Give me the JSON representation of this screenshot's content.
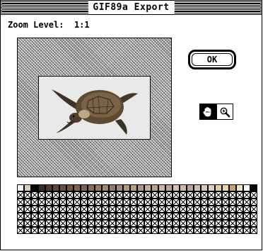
{
  "window": {
    "title": "GIF89a Export"
  },
  "zoom": {
    "label": "Zoom Level:",
    "value": "1:1"
  },
  "buttons": {
    "ok_label": "OK"
  },
  "tools": [
    {
      "name": "hand-tool",
      "icon": "hand-icon",
      "active": true
    },
    {
      "name": "zoom-tool",
      "icon": "magnifier-icon",
      "active": false
    }
  ],
  "palette": {
    "colors": [
      "#f2f2f2",
      "#d6cbbd",
      "#000000",
      "#3a2c22",
      "#4b3a2c",
      "#5a4636",
      "#6b4e37",
      "#74573f",
      "#806449",
      "#7b624f",
      "#8a6e53",
      "#957a5e",
      "#a0866b",
      "#8e7d6f",
      "#9e8c7b",
      "#ad9980",
      "#b39f86",
      "#a99784",
      "#c0ad95",
      "#b5a08a",
      "#c7b59f",
      "#bba594",
      "#d3c2a9",
      "#cdbb9e",
      "#b1a697",
      "#c9bfb1",
      "#d6c9b5",
      "#ddd0bc",
      "#e0cf9e",
      "#e8d7a5",
      "#c4a46b",
      "#efe3c8",
      "#ffffff",
      "#000000"
    ],
    "columns": 34,
    "empty_rows": 6
  }
}
